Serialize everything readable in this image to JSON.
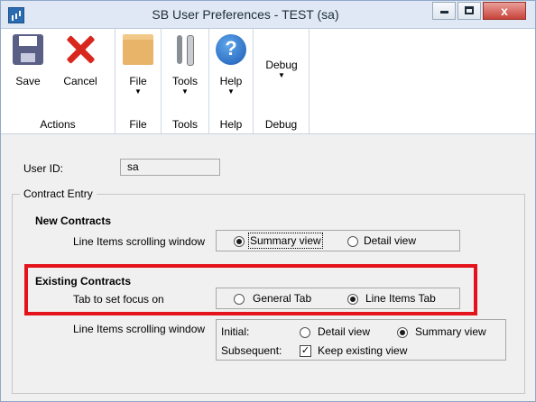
{
  "window": {
    "title": "SB User Preferences  -  TEST (sa)",
    "controls": {
      "close": "x"
    }
  },
  "ribbon": {
    "buttons": {
      "save": "Save",
      "cancel": "Cancel",
      "file": "File",
      "tools": "Tools",
      "help": "Help",
      "debug": "Debug"
    },
    "groups": {
      "actions": "Actions",
      "file": "File",
      "tools": "Tools",
      "help": "Help",
      "debug": "Debug"
    }
  },
  "form": {
    "user_id_label": "User ID:",
    "user_id_value": "sa",
    "contract_entry_label": "Contract Entry",
    "new_contracts": {
      "heading": "New Contracts",
      "row_label": "Line Items scrolling window",
      "options": [
        "Summary view",
        "Detail view"
      ],
      "selected": "Summary view"
    },
    "existing_contracts": {
      "heading": "Existing Contracts",
      "row_label": "Tab to set focus on",
      "options": [
        "General Tab",
        "Line Items Tab"
      ],
      "selected": "Line Items Tab",
      "scroll_label": "Line Items scrolling window",
      "initial_label": "Initial:",
      "initial_options": [
        "Detail view",
        "Summary view"
      ],
      "initial_selected": "Summary view",
      "subsequent_label": "Subsequent:",
      "keep_existing_label": "Keep existing view",
      "keep_existing_checked": true
    }
  },
  "colors": {
    "highlight_border": "#e3121b",
    "titlebar": "#dfe8f4"
  }
}
